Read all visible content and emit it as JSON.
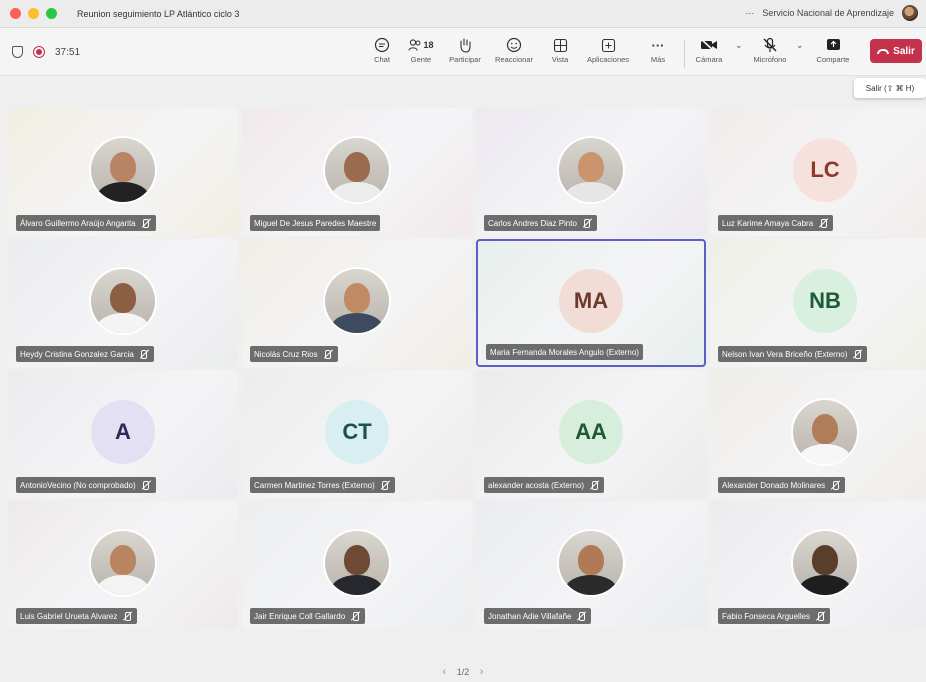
{
  "window": {
    "title": "Reunion seguimiento LP Atlántico ciclo 3",
    "more": "···",
    "org": "Servicio Nacional de Aprendizaje"
  },
  "toolbar": {
    "timer": "37:51",
    "chat": "Chat",
    "people_label": "Gente",
    "people_count": "18",
    "raise": "Participar",
    "react": "Reaccionar",
    "view": "Vista",
    "apps": "Aplicaciones",
    "more_label": "Más",
    "more_icon": "···",
    "camera": "Cámara",
    "mic": "Micrófono",
    "share": "Comparte",
    "leave": "Salir",
    "caret": "⌄"
  },
  "tooltip": "Salir (⇧ ⌘ H)",
  "participants": [
    {
      "name": "Álvaro Guillermo Araújo Angarita",
      "muted": true,
      "photo": true,
      "bg": "#f1eee2",
      "skin": "#b88463",
      "shirt": "#222222"
    },
    {
      "name": "Miguel De Jesus Paredes Maestre",
      "muted": false,
      "photo": true,
      "bg": "#f1e9ec",
      "skin": "#9a6b4c",
      "shirt": "#ececec"
    },
    {
      "name": "Carlos Andres Diaz Pinto",
      "muted": true,
      "photo": true,
      "bg": "#ece9f0",
      "skin": "#c9946e",
      "shirt": "#e6e6e6"
    },
    {
      "name": "Luz Karime Amaya Cabra",
      "muted": true,
      "photo": false,
      "initials": "LC",
      "bg": "#f1ecea",
      "avatar_bg": "#f7e1dc",
      "avatar_fg": "#8a3a2a"
    },
    {
      "name": "Heydy Cristina Gonzalez Garcia",
      "muted": true,
      "photo": true,
      "bg": "#ebeced",
      "skin": "#8c5e42",
      "shirt": "#f4f4f4"
    },
    {
      "name": "Nicolás Cruz Rios",
      "muted": true,
      "photo": true,
      "bg": "#f1eee6",
      "skin": "#c28a62",
      "shirt": "#3d4a60"
    },
    {
      "name": "Maria Fernanda Morales Angulo (Externo)",
      "muted": false,
      "photo": false,
      "initials": "MA",
      "bg": "#e8efec",
      "avatar_bg": "#f2ddd6",
      "avatar_fg": "#6b3a2e",
      "active": true
    },
    {
      "name": "Nelson Ivan Vera Briceño (Externo)",
      "muted": true,
      "photo": false,
      "initials": "NB",
      "bg": "#eef0e6",
      "avatar_bg": "#d9f0e1",
      "avatar_fg": "#1f5a36"
    },
    {
      "name": "AntonioVecino (No comprobado)",
      "muted": true,
      "photo": false,
      "initials": "A",
      "bg": "#ececef",
      "avatar_bg": "#e2e0f2",
      "avatar_fg": "#2d2a5a"
    },
    {
      "name": "Carmen Martinez Torres (Externo)",
      "muted": true,
      "photo": false,
      "initials": "CT",
      "bg": "#eeeceb",
      "avatar_bg": "#d9eef0",
      "avatar_fg": "#1f4f56"
    },
    {
      "name": "alexander acosta (Externo)",
      "muted": true,
      "photo": false,
      "initials": "AA",
      "bg": "#ecebeb",
      "avatar_bg": "#d8eedd",
      "avatar_fg": "#1f5a33"
    },
    {
      "name": "Alexander Donado Molinares",
      "muted": true,
      "photo": true,
      "bg": "#efede8",
      "skin": "#b17d58",
      "shirt": "#f7f7f7"
    },
    {
      "name": "Luis Gabriel Urueta Alvarez",
      "muted": true,
      "photo": true,
      "bg": "#eeeaeb",
      "skin": "#b98560",
      "shirt": "#f3f3f3"
    },
    {
      "name": "Jair Enrique Coll Gallardo",
      "muted": true,
      "photo": true,
      "bg": "#eceef0",
      "skin": "#6e4a33",
      "shirt": "#26282e"
    },
    {
      "name": "Jonathan Adie Villafañe",
      "muted": true,
      "photo": true,
      "bg": "#eaecef",
      "skin": "#b07a55",
      "shirt": "#2b2b2b"
    },
    {
      "name": "Fabio Fonseca Arguelles",
      "muted": true,
      "photo": true,
      "bg": "#ecebed",
      "skin": "#5a3e2c",
      "shirt": "#1e1e1e"
    }
  ],
  "pager": {
    "prev": "‹",
    "label": "1/2",
    "next": "›"
  }
}
